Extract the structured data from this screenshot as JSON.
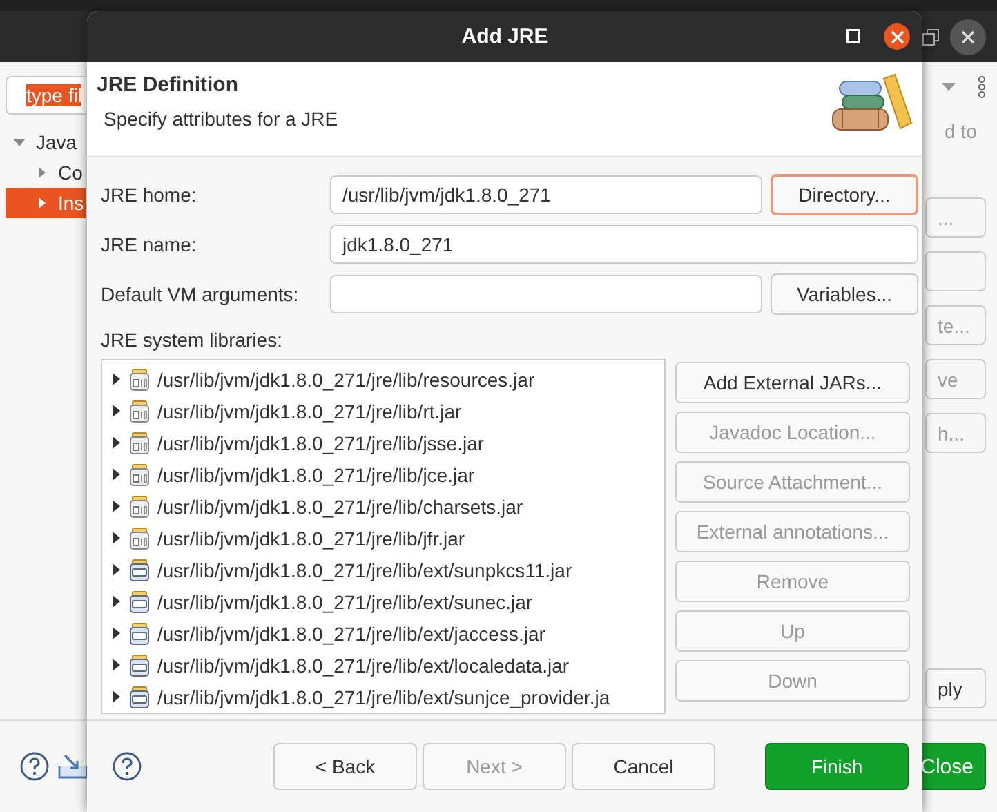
{
  "background_window": {
    "filter": {
      "value": "type fil",
      "selected": true
    },
    "tree": [
      {
        "label": "Java",
        "expanded": true,
        "selected": false,
        "children": [
          {
            "label": "Co",
            "expanded": false,
            "selected": false
          },
          {
            "label": "Ins",
            "expanded": false,
            "selected": true
          }
        ]
      }
    ],
    "description": "d to",
    "side_buttons": [
      {
        "kind": "text",
        "label": "..."
      },
      {
        "kind": "blank"
      },
      {
        "kind": "text",
        "label": "te..."
      },
      {
        "kind": "text",
        "label": "ve"
      },
      {
        "kind": "text",
        "label": "h..."
      }
    ],
    "apply_button": "ply",
    "close_button": "Close"
  },
  "dialog": {
    "title": "Add JRE",
    "header_title": "JRE Definition",
    "header_description": "Specify attributes for a JRE",
    "fields": [
      {
        "label": "JRE home:",
        "value": "/usr/lib/jvm/jdk1.8.0_271",
        "button": "Directory...",
        "focused": true
      },
      {
        "label": "JRE name:",
        "value": "jdk1.8.0_271"
      },
      {
        "label": "Default VM arguments:",
        "button": "Variables...",
        "focused": false
      }
    ],
    "libraries_label": "JRE system libraries:",
    "libraries": [
      {
        "path": "/usr/lib/jvm/jdk1.8.0_271/jre/lib/resources.jar",
        "kind": "archive",
        "expanded": false
      },
      {
        "path": "/usr/lib/jvm/jdk1.8.0_271/jre/lib/rt.jar",
        "kind": "archive",
        "expanded": false
      },
      {
        "path": "/usr/lib/jvm/jdk1.8.0_271/jre/lib/jsse.jar",
        "kind": "archive",
        "expanded": false
      },
      {
        "path": "/usr/lib/jvm/jdk1.8.0_271/jre/lib/jce.jar",
        "kind": "archive",
        "expanded": false
      },
      {
        "path": "/usr/lib/jvm/jdk1.8.0_271/jre/lib/charsets.jar",
        "kind": "archive",
        "expanded": false
      },
      {
        "path": "/usr/lib/jvm/jdk1.8.0_271/jre/lib/jfr.jar",
        "kind": "archive",
        "expanded": false
      },
      {
        "path": "/usr/lib/jvm/jdk1.8.0_271/jre/lib/ext/sunpkcs11.jar",
        "kind": "binary",
        "expanded": false
      },
      {
        "path": "/usr/lib/jvm/jdk1.8.0_271/jre/lib/ext/sunec.jar",
        "kind": "binary",
        "expanded": false
      },
      {
        "path": "/usr/lib/jvm/jdk1.8.0_271/jre/lib/ext/jaccess.jar",
        "kind": "binary",
        "expanded": false
      },
      {
        "path": "/usr/lib/jvm/jdk1.8.0_271/jre/lib/ext/localedata.jar",
        "kind": "binary",
        "expanded": false
      },
      {
        "path": "/usr/lib/jvm/jdk1.8.0_271/jre/lib/ext/sunjce_provider.ja",
        "kind": "binary",
        "expanded": false
      }
    ],
    "library_buttons": [
      {
        "label": "Add External JARs...",
        "disabled": false
      },
      {
        "label": "Javadoc Location...",
        "disabled": true
      },
      {
        "label": "Source Attachment...",
        "disabled": true
      },
      {
        "label": "External annotations...",
        "disabled": true
      },
      {
        "label": "Remove",
        "disabled": true
      },
      {
        "label": "Up",
        "disabled": true
      },
      {
        "label": "Down",
        "disabled": true
      }
    ],
    "footer_buttons": [
      {
        "label": "< Back",
        "disabled": false,
        "default": false
      },
      {
        "label": "Next >",
        "disabled": true,
        "default": false
      },
      {
        "label": "Cancel",
        "disabled": false,
        "default": false
      },
      {
        "label": "Finish",
        "disabled": false,
        "default": true
      }
    ]
  }
}
